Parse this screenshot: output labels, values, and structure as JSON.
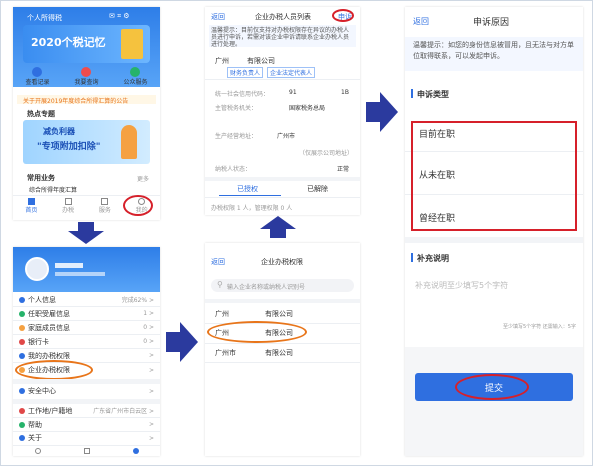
{
  "colors": {
    "primary_blue": "#2f6fe0",
    "arrow_navy": "#2b3a9e",
    "highlight_red": "#d6202a",
    "highlight_orange": "#e8751a",
    "banner_blue": "#3a8df0"
  },
  "p1": {
    "app_title": "个人所得税",
    "banner_title": "2020个税记忆",
    "quick_actions": [
      "查看记录",
      "我要查询",
      "公众服务"
    ],
    "notice": "关于开展2019年度综合所得汇算的公告",
    "section_hot": "热点专题",
    "promo_line1": "减负利器",
    "promo_line2": "\"专项附加扣除\"",
    "section_common": "常用业务",
    "more_label": "更多",
    "common_item": "综合所得年度汇算",
    "tabbar": [
      "首页",
      "办税",
      "服务",
      "我的"
    ]
  },
  "p2": {
    "menu": [
      {
        "label": "个人信息",
        "value": "完成62% >"
      },
      {
        "label": "任职受雇信息",
        "value": "1 >"
      },
      {
        "label": "家庭成员信息",
        "value": "0 >"
      },
      {
        "label": "银行卡",
        "value": "0 >"
      },
      {
        "label": "我的办税权限",
        "value": ">"
      },
      {
        "label": "企业办税权限",
        "value": ">"
      },
      {
        "label": "安全中心",
        "value": ">"
      },
      {
        "label": "工作地/户籍地",
        "value": "广东省广州市白云区 >"
      },
      {
        "label": "帮助",
        "value": ">"
      },
      {
        "label": "关于",
        "value": ">"
      }
    ]
  },
  "p3": {
    "back": "返回",
    "title": "企业办税人员列表",
    "action": "申诉",
    "tip": "温馨提示：目前仅支持对办税权限存在异议的办税人员进行申诉，若需对该企业申诉请联系企业办税人员进行处理。",
    "company_city": "广州",
    "company_name": "有限公司",
    "company_tag1": "财务负责人",
    "company_tag2": "企业法定代表人",
    "field1_label": "统一社会信用代码：",
    "field1_value": "91",
    "field1_suffix": "1B",
    "field2_label": "主管税务机关：",
    "field2_value": "国家税务总局",
    "field3_label": "生产经营地址：",
    "field3_value": "广州市",
    "field3_extra": "（仅展示公司地址）",
    "field4_label": "纳税人状态：",
    "field4_value": "正常",
    "tab_active": "已授权",
    "tab_inactive": "已解除",
    "count_line": "办税权限 1 人，管理权限 0 人"
  },
  "p4": {
    "back": "返回",
    "title": "企业办税权限",
    "search_placeholder": "输入企业名称或纳税人识别号",
    "rows": [
      {
        "city": "广州",
        "name": "有限公司"
      },
      {
        "city": "广州",
        "name": "有限公司"
      },
      {
        "city": "广州市",
        "name": "有限公司"
      }
    ]
  },
  "p5": {
    "back": "返回",
    "title": "申诉原因",
    "tip": "温馨提示：如您的身份信息被冒用，且无法与对方单位取得联系，可以发起申诉。",
    "type_header": "申诉类型",
    "options": [
      "目前在职",
      "从未在职",
      "曾经在职"
    ],
    "note_header": "补充说明",
    "note_placeholder": "补充说明至少填写5个字符",
    "counter": "至少填写5个字符 还需输入：5字",
    "submit": "提交"
  }
}
